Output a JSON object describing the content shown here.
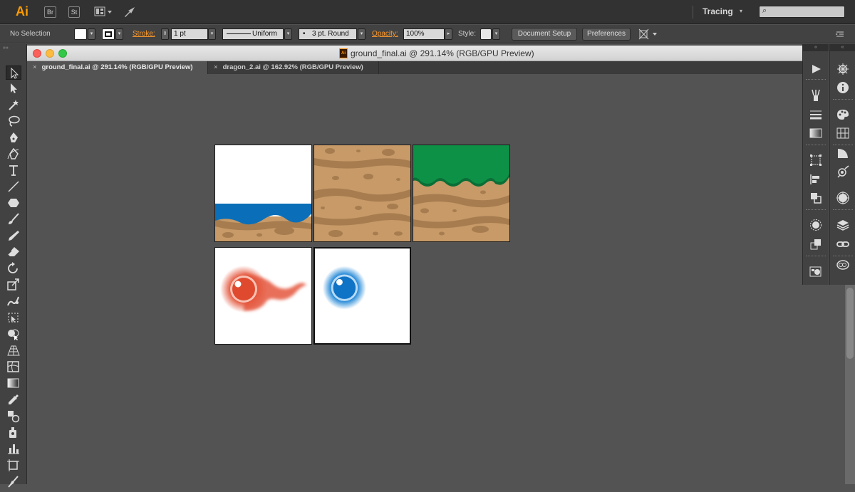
{
  "app": {
    "logo": "Ai",
    "bridge_label": "Br",
    "stock_label": "St",
    "workspace": "Tracing",
    "search_placeholder": ""
  },
  "control_bar": {
    "selection_label": "No Selection",
    "stroke_label": "Stroke:",
    "stroke_value": "1 pt",
    "profile_label": "Uniform",
    "brush_label": "3 pt. Round",
    "opacity_label": "Opacity:",
    "opacity_value": "100%",
    "style_label": "Style:",
    "document_setup": "Document Setup",
    "preferences": "Preferences"
  },
  "document": {
    "window_title": "ground_final.ai @ 291.14% (RGB/GPU Preview)",
    "icon_label": "Ai",
    "tabs": [
      {
        "label": "ground_final.ai @ 291.14% (RGB/GPU Preview)",
        "active": true
      },
      {
        "label": "dragon_2.ai @ 162.92% (RGB/GPU Preview)",
        "active": false
      }
    ]
  },
  "colors": {
    "app_bg": "#323232",
    "panel_bg": "#424242",
    "canvas_bg": "#535353",
    "accent": "#ff9a00",
    "water": "#0a6fb8",
    "dirt": "#c79a68",
    "dirt_dark": "#a77c4f",
    "grass": "#0d9147",
    "fireball": "#e4563c",
    "bubble": "#1f86d6"
  },
  "artboards": [
    {
      "name": "water-tile"
    },
    {
      "name": "dirt-tile"
    },
    {
      "name": "grass-tile"
    },
    {
      "name": "fireball-sprite"
    },
    {
      "name": "bubble-sprite"
    }
  ]
}
